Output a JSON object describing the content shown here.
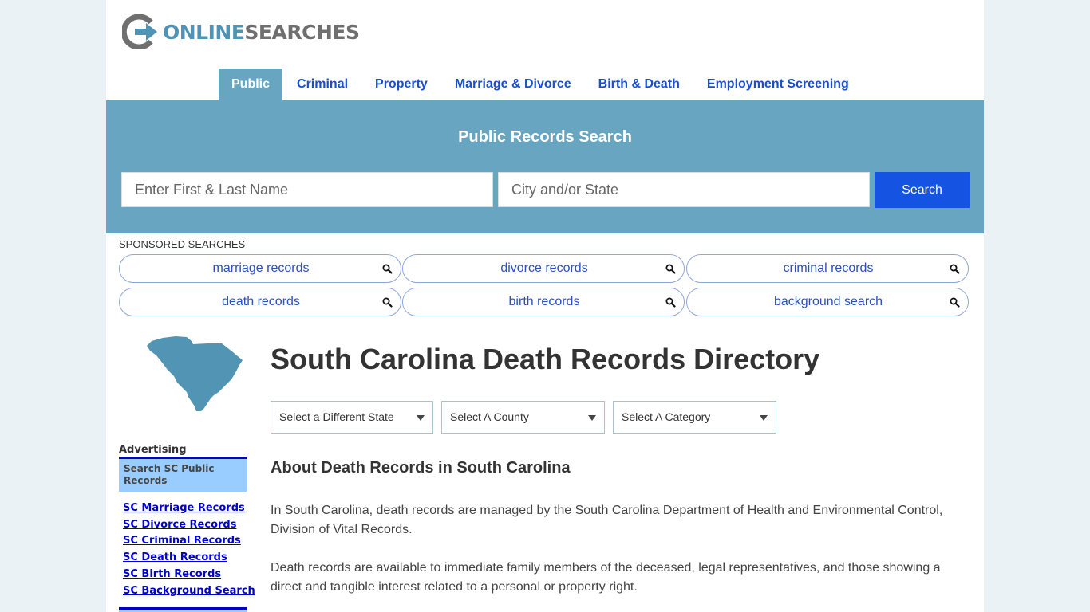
{
  "header": {
    "logo": {
      "part1": "ONLINE",
      "part2": "SEARCHES",
      "icon": "logo-arrow-icon"
    },
    "nav": [
      {
        "label": "Public",
        "active": true
      },
      {
        "label": "Criminal",
        "active": false
      },
      {
        "label": "Property",
        "active": false
      },
      {
        "label": "Marriage & Divorce",
        "active": false
      },
      {
        "label": "Birth & Death",
        "active": false
      },
      {
        "label": "Employment Screening",
        "active": false
      }
    ]
  },
  "hero": {
    "title": "Public Records Search",
    "name_placeholder": "Enter First & Last Name",
    "city_placeholder": "City and/or State",
    "search_label": "Search"
  },
  "sponsored": {
    "label": "SPONSORED SEARCHES",
    "items": [
      {
        "label": "marriage records",
        "icon": "search-icon"
      },
      {
        "label": "divorce records",
        "icon": "search-icon"
      },
      {
        "label": "criminal records",
        "icon": "search-icon"
      },
      {
        "label": "death records",
        "icon": "search-icon"
      },
      {
        "label": "birth records",
        "icon": "search-icon"
      },
      {
        "label": "background search",
        "icon": "search-icon"
      }
    ]
  },
  "sidebar": {
    "state_image": "south-carolina-map",
    "advertising_title": "Advertising",
    "ad_box_text": "Search SC Public Records",
    "links": [
      "SC Marriage Records",
      "SC Divorce Records",
      "SC Criminal Records",
      "SC Death Records",
      "SC Birth Records",
      "SC Background Search"
    ]
  },
  "main": {
    "title": "South Carolina Death Records Directory",
    "selects": {
      "state": "Select a Different State",
      "county": "Select A County",
      "category": "Select A Category"
    },
    "section_title": "About Death Records in South Carolina",
    "paragraphs": [
      "In South Carolina, death records are managed by the South Carolina Department of Health and Environmental Control, Division of Vital Records.",
      "Death records are available to immediate family members of the deceased, legal representatives, and those showing a direct and tangible interest related to a personal or property right."
    ]
  },
  "colors": {
    "page_bg": "#eaf2f6",
    "hero_bg": "#67a5c0",
    "nav_link": "#1a4fc9",
    "search_button": "#1553e3",
    "ad_box": "#99ccff",
    "ad_link": "#0000cc"
  }
}
